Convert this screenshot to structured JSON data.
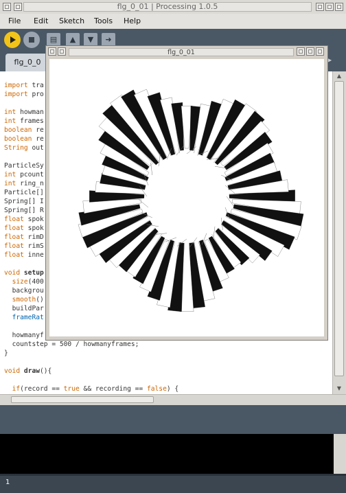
{
  "window": {
    "title": "flg_0_01 | Processing 1.0.5"
  },
  "menu": [
    "File",
    "Edit",
    "Sketch",
    "Tools",
    "Help"
  ],
  "toolbar": {
    "run": "run-icon",
    "stop": "stop-icon",
    "new": "new-icon",
    "open": "open-icon",
    "save": "save-icon",
    "export": "export-icon"
  },
  "tabs": [
    {
      "label": "flg_0_0"
    }
  ],
  "sketch_window": {
    "title": "flg_0_01"
  },
  "code": {
    "lines": [
      "import tra",
      "import pro",
      "",
      "int howman",
      "int frames",
      "boolean re",
      "boolean re",
      "String out",
      "",
      "ParticleSy",
      "int pcount",
      "int ring_n",
      "Particle[]",
      "Spring[] I",
      "Spring[] R",
      "float spok",
      "float spok",
      "float rimD",
      "float rimS",
      "float inne",
      "",
      "void setup",
      "  size(400",
      "  backgrou",
      "  smooth()",
      "  buildPar",
      "  frameRat",
      "",
      "  howmanyf",
      "  countstep = 500 / howmanyframes;",
      "}",
      "",
      "void draw(){",
      "",
      "  if(record == true && recording == false) {"
    ]
  },
  "status": {
    "line": "1"
  },
  "colors": {
    "toolbar": "#4a5764",
    "run": "#f2c418",
    "keyword": "#cc6600",
    "function": "#0066b0"
  }
}
